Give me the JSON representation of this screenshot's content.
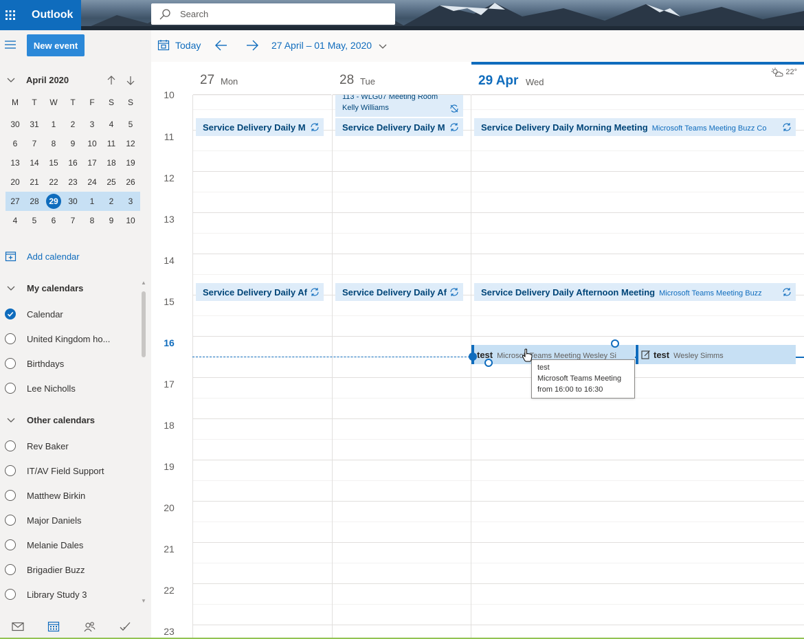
{
  "app": {
    "name": "Outlook",
    "search_placeholder": "Search",
    "icons": {
      "waffle": "app-launcher-icon",
      "search": "search-icon"
    }
  },
  "sidebar": {
    "new_event_label": "New event",
    "mini_calendar": {
      "month_label": "April 2020",
      "weekday_headers": [
        "M",
        "T",
        "W",
        "T",
        "F",
        "S",
        "S"
      ],
      "weeks": [
        [
          "30",
          "31",
          "1",
          "2",
          "3",
          "4",
          "5"
        ],
        [
          "6",
          "7",
          "8",
          "9",
          "10",
          "11",
          "12"
        ],
        [
          "13",
          "14",
          "15",
          "16",
          "17",
          "18",
          "19"
        ],
        [
          "20",
          "21",
          "22",
          "23",
          "24",
          "25",
          "26"
        ],
        [
          "27",
          "28",
          "29",
          "30",
          "1",
          "2",
          "3"
        ],
        [
          "4",
          "5",
          "6",
          "7",
          "8",
          "9",
          "10"
        ]
      ],
      "selected_week_index": 4,
      "today": "29"
    },
    "add_calendar_label": "Add calendar",
    "my_calendars": {
      "title": "My calendars",
      "items": [
        {
          "label": "Calendar",
          "checked": true
        },
        {
          "label": "United Kingdom ho...",
          "checked": false
        },
        {
          "label": "Birthdays",
          "checked": false
        },
        {
          "label": "Lee Nicholls",
          "checked": false
        }
      ]
    },
    "other_calendars": {
      "title": "Other calendars",
      "items": [
        {
          "label": "Rev Baker"
        },
        {
          "label": "IT/AV Field Support"
        },
        {
          "label": "Matthew Birkin"
        },
        {
          "label": "Major Daniels"
        },
        {
          "label": "Melanie Dales"
        },
        {
          "label": "Brigadier Buzz"
        },
        {
          "label": "Library Study 3"
        }
      ]
    },
    "bottom_nav": [
      "mail-icon",
      "calendar-icon",
      "people-icon",
      "tasks-icon"
    ]
  },
  "toolbar": {
    "today_label": "Today",
    "date_range": "27 April – 01 May, 2020"
  },
  "calendar": {
    "days": [
      {
        "num": "27",
        "name": "Mon",
        "today": false
      },
      {
        "num": "28",
        "name": "Tue",
        "today": false
      },
      {
        "num": "29 Apr",
        "name": "Wed",
        "today": true
      }
    ],
    "weather": "22°",
    "hours": [
      "10",
      "11",
      "12",
      "13",
      "14",
      "15",
      "16",
      "17",
      "18",
      "19",
      "20",
      "21",
      "22",
      "23"
    ],
    "current_hour": "16",
    "events": {
      "tue_small_line1": "113 - WLG07 Meeting Room",
      "tue_small_line2": "Kelly Williams",
      "mon_morning": "Service Delivery Daily M",
      "tue_morning": "Service Delivery Daily M",
      "wed_morning_title": "Service Delivery Daily Morning Meeting",
      "wed_morning_sub": "Microsoft Teams Meeting Buzz Co",
      "mon_afternoon": "Service Delivery Daily Af",
      "tue_afternoon": "Service Delivery Daily Af",
      "wed_afternoon_title": "Service Delivery Daily Afternoon Meeting",
      "wed_afternoon_sub": "Microsoft Teams Meeting Buzz",
      "test1_title": "test",
      "test1_sub": "Microsoft Teams Meeting Wesley Si",
      "test2_title": "test",
      "test2_sub": "Wesley Simms"
    },
    "tooltip": {
      "line1": "test",
      "line2": "Microsoft Teams Meeting",
      "line3": "from 16:00 to 16:30"
    }
  }
}
